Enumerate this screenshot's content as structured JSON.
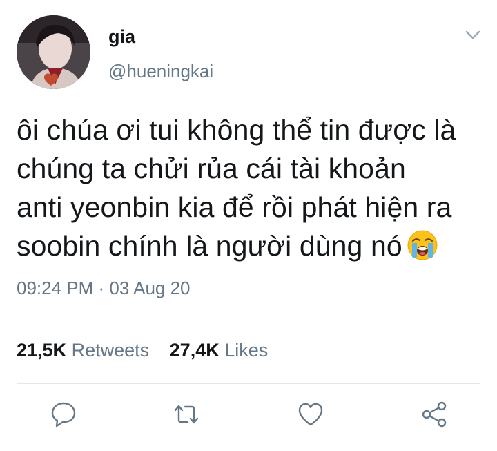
{
  "author": {
    "display_name": "gia",
    "handle": "@hueningkai"
  },
  "tweet": {
    "lines": [
      "ôi chúa ơi tui không thể tin được là",
      "chúng ta chửi rủa cái tài khoản",
      "anti yeonbin kia để rồi phát hiện ra",
      "soobin chính là người dùng nó"
    ],
    "emoji": "loudly-crying-face-emoji",
    "timestamp": "09:24 PM · 03 Aug 20"
  },
  "stats": {
    "retweets_count": "21,5K",
    "retweets_label": "Retweets",
    "likes_count": "27,4K",
    "likes_label": "Likes"
  },
  "icons": {
    "menu": "chevron-down-icon",
    "reply": "reply-icon",
    "retweet": "retweet-icon",
    "like": "heart-icon",
    "share": "share-icon"
  },
  "colors": {
    "text": "#14171a",
    "secondary": "#657786",
    "divider": "#e1e8ed"
  }
}
